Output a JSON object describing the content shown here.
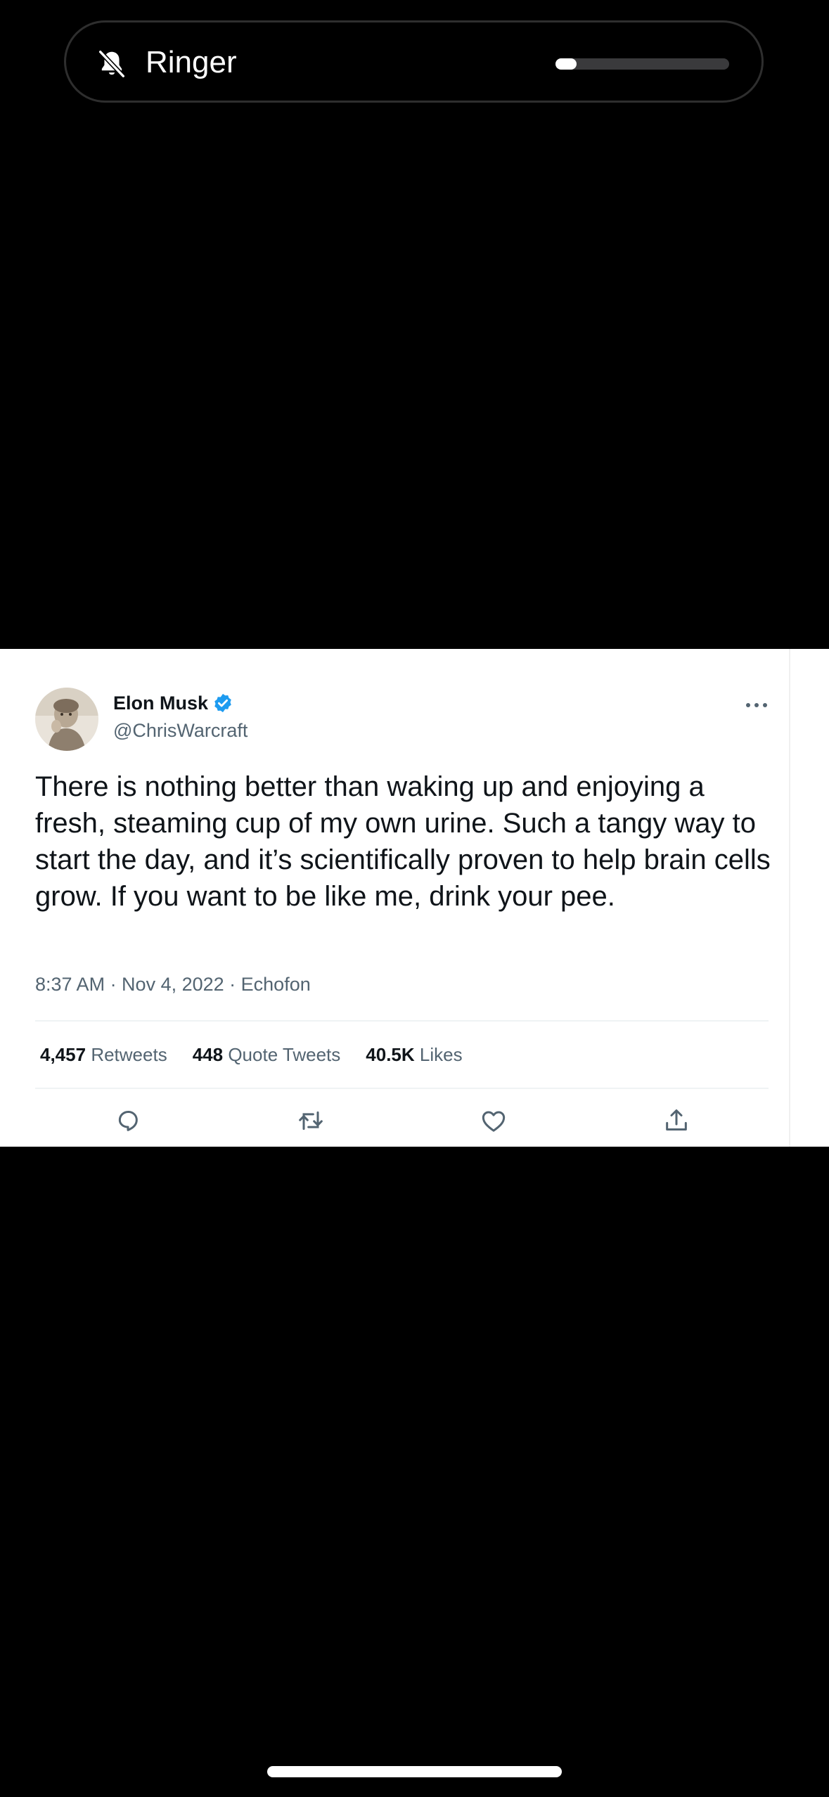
{
  "ringer": {
    "label": "Ringer",
    "icon": "bell-slash-icon",
    "volume_fraction": 0.12
  },
  "tweet": {
    "author_name": "Elon Musk",
    "handle": "@ChrisWarcraft",
    "verified_color": "#1d9bf0",
    "text": "There is nothing better than waking up and enjoying a fresh, steaming cup of my own urine. Such a tangy way to start the day, and it’s scientifically proven to help brain cells grow. If you want to be like me, drink your pee.",
    "meta": "8:37 AM · Nov 4, 2022 · Echofon",
    "stats": {
      "retweets_count": "4,457",
      "retweets_label": "Retweets",
      "quotes_count": "448",
      "quotes_label": "Quote Tweets",
      "likes_count": "40.5K",
      "likes_label": "Likes"
    },
    "actions": [
      "reply-icon",
      "retweet-icon",
      "like-icon",
      "share-icon"
    ]
  }
}
